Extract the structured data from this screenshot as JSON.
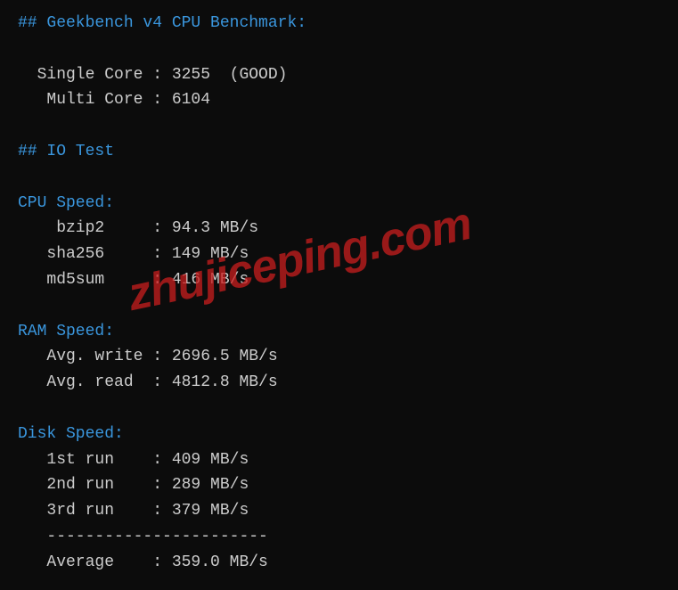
{
  "sections": {
    "geekbench": {
      "title": "## Geekbench v4 CPU Benchmark:",
      "single_label": "  Single Core : ",
      "single_value": "3255  (GOOD)",
      "multi_label": "   Multi Core : ",
      "multi_value": "6104"
    },
    "io_test": {
      "title": "## IO Test"
    },
    "cpu_speed": {
      "title": "CPU Speed:",
      "bzip2_label": "    bzip2     : ",
      "bzip2_value": "94.3 MB/s",
      "sha256_label": "   sha256     : ",
      "sha256_value": "149 MB/s",
      "md5sum_label": "   md5sum     : ",
      "md5sum_value": "416 MB/s"
    },
    "ram_speed": {
      "title": "RAM Speed:",
      "write_label": "   Avg. write : ",
      "write_value": "2696.5 MB/s",
      "read_label": "   Avg. read  : ",
      "read_value": "4812.8 MB/s"
    },
    "disk_speed": {
      "title": "Disk Speed:",
      "run1_label": "   1st run    : ",
      "run1_value": "409 MB/s",
      "run2_label": "   2nd run    : ",
      "run2_value": "289 MB/s",
      "run3_label": "   3rd run    : ",
      "run3_value": "379 MB/s",
      "divider": "   -----------------------",
      "avg_label": "   Average    : ",
      "avg_value": "359.0 MB/s"
    }
  },
  "watermark": "zhujiceping.com"
}
